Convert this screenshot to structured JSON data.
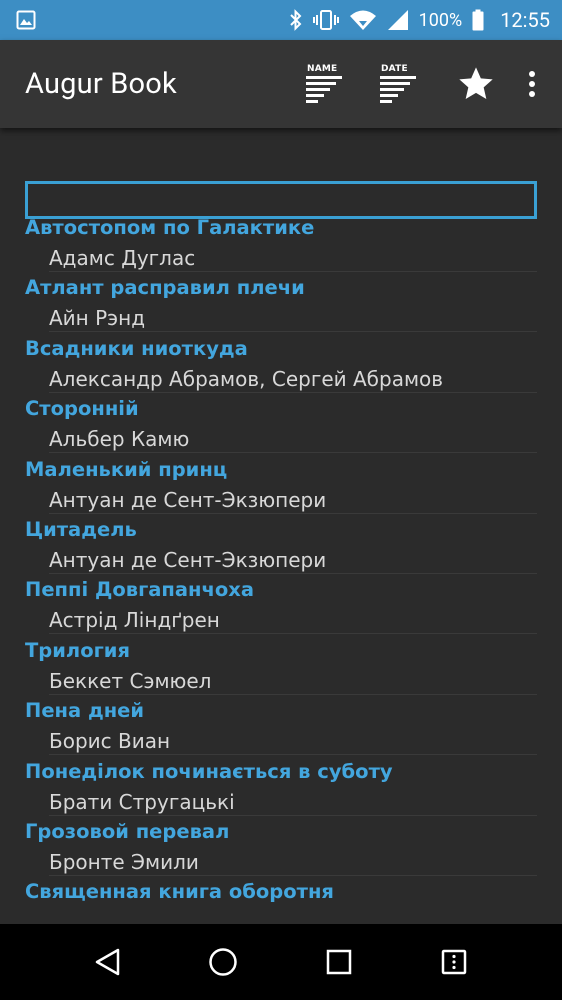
{
  "status_bar": {
    "battery_percent": "100%",
    "time": "12:55",
    "icons": [
      "image-icon",
      "bluetooth-icon",
      "vibrate-icon",
      "wifi-icon",
      "signal-icon",
      "battery-icon"
    ]
  },
  "app_bar": {
    "title": "Augur Book",
    "sort_by_name_label": "NAME",
    "sort_by_date_label": "DATE",
    "actions": [
      "sort-by-name-icon",
      "sort-by-date-icon",
      "star-icon",
      "overflow-menu-icon"
    ]
  },
  "search": {
    "value": "",
    "placeholder": ""
  },
  "books": [
    {
      "title": "Автостопом по Галактике",
      "author": "Адамс Дуглас"
    },
    {
      "title": "Атлант расправил плечи",
      "author": "Айн Рэнд"
    },
    {
      "title": "Всадники ниоткуда",
      "author": "Александр Абрамов, Сергей Абрамов"
    },
    {
      "title": "Сторонній",
      "author": "Альбер Камю"
    },
    {
      "title": "Маленький принц",
      "author": "Антуан де Сент-Экзюпери"
    },
    {
      "title": "Цитадель",
      "author": "Антуан де Сент-Экзюпери"
    },
    {
      "title": "Пеппі Довгапанчоха",
      "author": "Астрід Ліндґрен"
    },
    {
      "title": "Трилогия",
      "author": "Беккет Сэмюел"
    },
    {
      "title": "Пена дней",
      "author": "Борис Виан"
    },
    {
      "title": "Понеділок починається в суботу",
      "author": "Брати Стругацькі"
    },
    {
      "title": "Грозовой перевал",
      "author": "Бронте Эмили"
    },
    {
      "title": "Священная книга оборотня",
      "author": ""
    }
  ],
  "colors": {
    "status_bar": "#3d8ec4",
    "app_bar": "#353535",
    "background": "#2b2b2b",
    "accent": "#43a6de",
    "author_text": "#d8d8d8"
  },
  "nav_bar": {
    "buttons": [
      "back-icon",
      "home-icon",
      "recents-icon",
      "menu-icon"
    ]
  }
}
